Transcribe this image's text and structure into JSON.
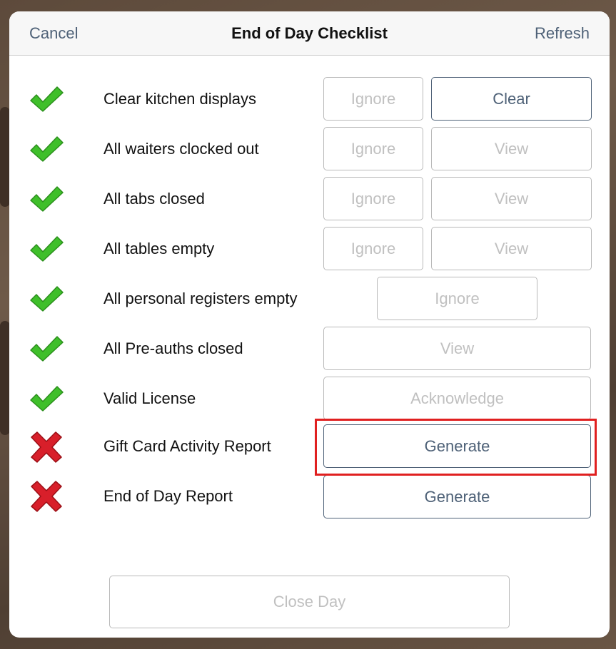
{
  "nav": {
    "cancel": "Cancel",
    "title": "End of Day Checklist",
    "refresh": "Refresh"
  },
  "items": [
    {
      "label": "Clear kitchen displays",
      "status": "done",
      "buttons": [
        "Ignore",
        "Clear"
      ]
    },
    {
      "label": "All waiters clocked out",
      "status": "done",
      "buttons": [
        "Ignore",
        "View"
      ]
    },
    {
      "label": "All tabs closed",
      "status": "done",
      "buttons": [
        "Ignore",
        "View"
      ]
    },
    {
      "label": "All tables empty",
      "status": "done",
      "buttons": [
        "Ignore",
        "View"
      ]
    },
    {
      "label": "All personal registers empty",
      "status": "done",
      "buttons": [
        "Ignore"
      ]
    },
    {
      "label": "All Pre-auths closed",
      "status": "done",
      "buttons": [
        "View"
      ]
    },
    {
      "label": "Valid License",
      "status": "done",
      "buttons": [
        "Acknowledge"
      ]
    },
    {
      "label": "Gift Card Activity Report",
      "status": "failed",
      "buttons": [
        "Generate"
      ]
    },
    {
      "label": "End of Day Report",
      "status": "failed",
      "buttons": [
        "Generate"
      ]
    }
  ],
  "footer": {
    "close_day": "Close Day"
  },
  "colors": {
    "accent": "#4e6177",
    "check": "#3fbf2a",
    "cross": "#d81f2a",
    "highlight": "#e02020"
  }
}
